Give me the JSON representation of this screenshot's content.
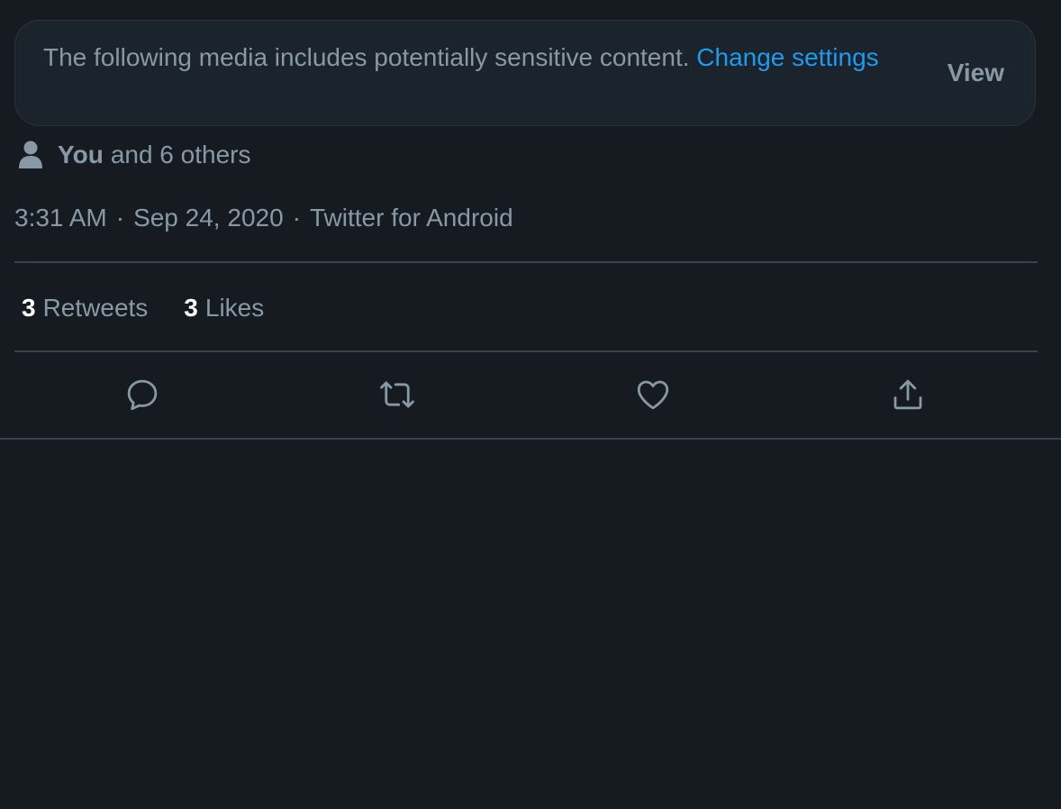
{
  "sensitive_notice": {
    "text": "The following media includes potentially sensitive content.",
    "link_label": "Change settings",
    "view_label": "View"
  },
  "tagged": {
    "icon": "person-icon",
    "you_label": "You",
    "rest_label": "and 6 others"
  },
  "meta": {
    "time": "3:31 AM",
    "separator": "·",
    "date": "Sep 24, 2020",
    "source": "Twitter for Android"
  },
  "stats": {
    "retweets_count": "3",
    "retweets_label": "Retweets",
    "likes_count": "3",
    "likes_label": "Likes"
  },
  "actions": [
    {
      "icon": "reply-icon"
    },
    {
      "icon": "retweet-icon"
    },
    {
      "icon": "like-icon"
    },
    {
      "icon": "share-icon"
    }
  ],
  "colors": {
    "background": "#161b22",
    "accent": "#1d9bf0",
    "secondary_text": "#8899a6",
    "divider": "#38444d"
  }
}
